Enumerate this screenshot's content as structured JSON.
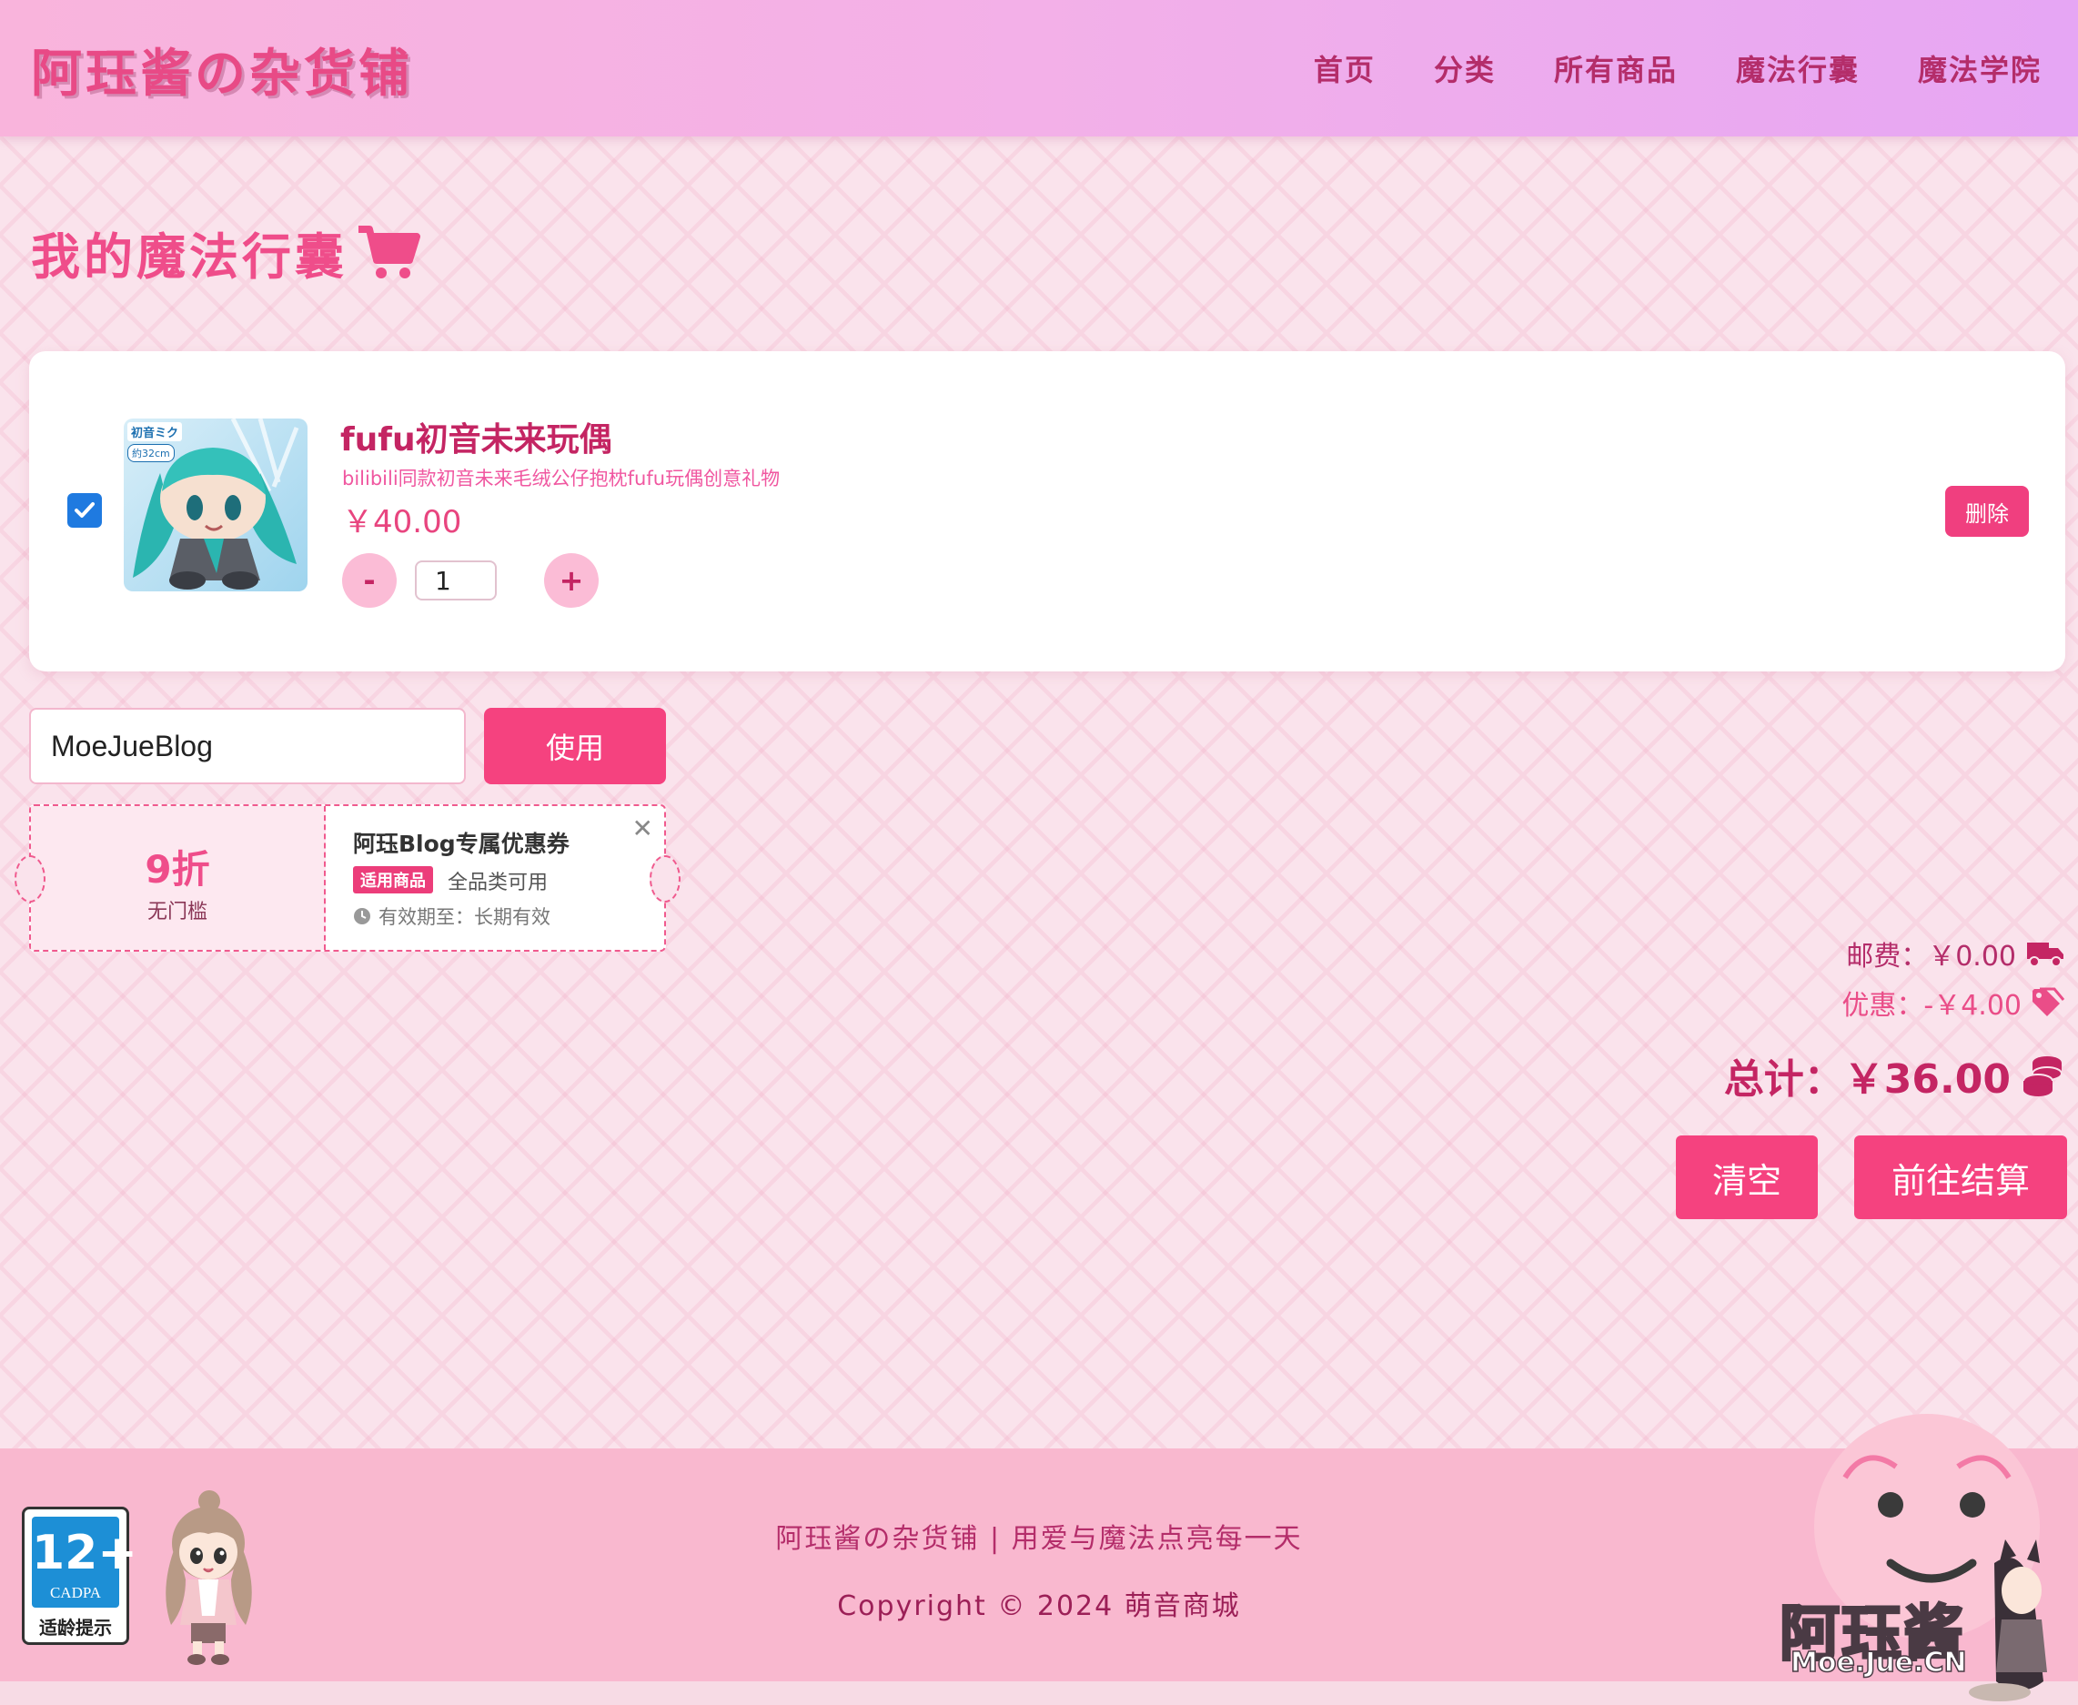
{
  "header": {
    "logo": "阿珏酱の杂货铺",
    "nav": [
      "首页",
      "分类",
      "所有商品",
      "魔法行囊",
      "魔法学院"
    ]
  },
  "page": {
    "title": "我的魔法行囊"
  },
  "cart": {
    "items": [
      {
        "checked": true,
        "name": "fufu初音未来玩偶",
        "description": "bilibili同款初音未来毛绒公仔抱枕fufu玩偶创意礼物",
        "price": "￥40.00",
        "quantity": "1",
        "minus_label": "-",
        "plus_label": "+",
        "delete_label": "删除",
        "image_badges": [
          "初音ミク",
          "約32cm"
        ]
      }
    ]
  },
  "coupon": {
    "code_value": "MoeJueBlog",
    "apply_label": "使用",
    "discount": "9折",
    "threshold": "无门槛",
    "title": "阿珏Blog专属优惠券",
    "tag": "适用商品",
    "scope": "全品类可用",
    "expiry": "有效期至：长期有效",
    "close_symbol": "✕"
  },
  "summary": {
    "shipping": "邮费：￥0.00",
    "discount": "优惠：-￥4.00",
    "total": "总计：￥36.00",
    "clear_label": "清空",
    "checkout_label": "前往结算"
  },
  "footer": {
    "tagline": "阿珏酱の杂货铺 | 用爱与魔法点亮每一天",
    "copyright": "Copyright © 2024 萌音商城",
    "age_rating": "12+",
    "age_org": "CADPA",
    "age_text": "适龄提示",
    "watermark": "阿珏酱",
    "watermark_sub": "Moe.Jue.CN"
  },
  "colors": {
    "accent": "#f5427f",
    "header_start": "#f9b4dc",
    "header_end": "#e6a6f4",
    "text_dark_pink": "#c42563",
    "background": "#fae3ec",
    "footer": "#f9b8cf"
  },
  "icons": [
    "shopping-cart-icon",
    "checkbox-checked-icon",
    "clock-icon",
    "close-icon",
    "truck-icon",
    "tag-icon",
    "coins-icon"
  ]
}
